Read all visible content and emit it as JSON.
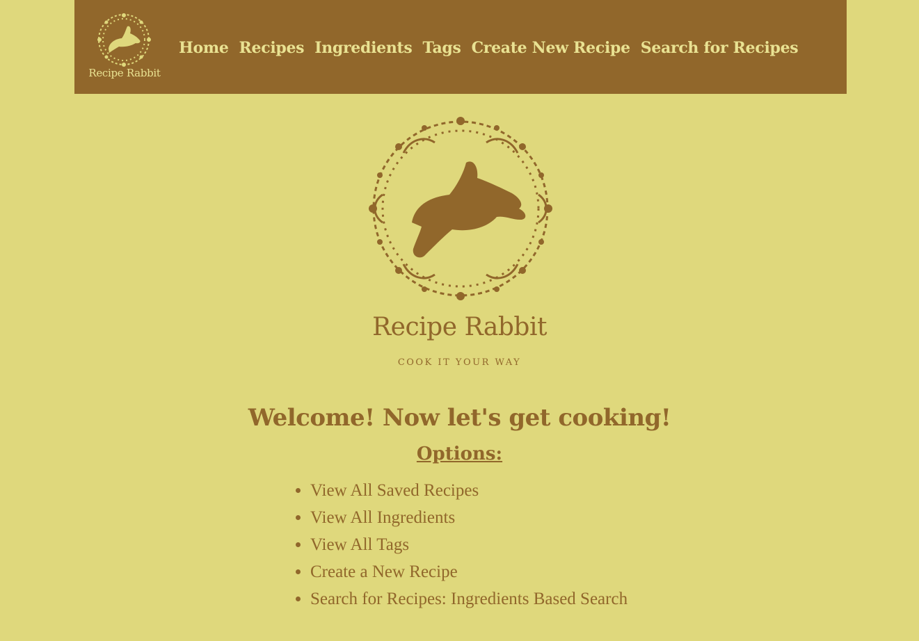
{
  "nav": {
    "logo_text": "Recipe Rabbit",
    "links": [
      {
        "label": "Home"
      },
      {
        "label": "Recipes"
      },
      {
        "label": "Ingredients"
      },
      {
        "label": "Tags"
      },
      {
        "label": "Create New Recipe"
      },
      {
        "label": "Search for Recipes"
      }
    ]
  },
  "hero": {
    "brand": "Recipe Rabbit",
    "tagline": "COOK IT YOUR WAY"
  },
  "main": {
    "welcome": "Welcome! Now let's get cooking!",
    "options_heading": "Options:",
    "options": [
      {
        "label": "View All Saved Recipes"
      },
      {
        "label": "View All Ingredients"
      },
      {
        "label": "View All Tags"
      },
      {
        "label": "Create a New Recipe"
      },
      {
        "label": "Search for Recipes: Ingredients Based Search"
      }
    ]
  },
  "colors": {
    "background": "#dfd87c",
    "nav_background": "#91672b",
    "nav_text": "#e9e292",
    "brand_brown": "#91672b"
  }
}
